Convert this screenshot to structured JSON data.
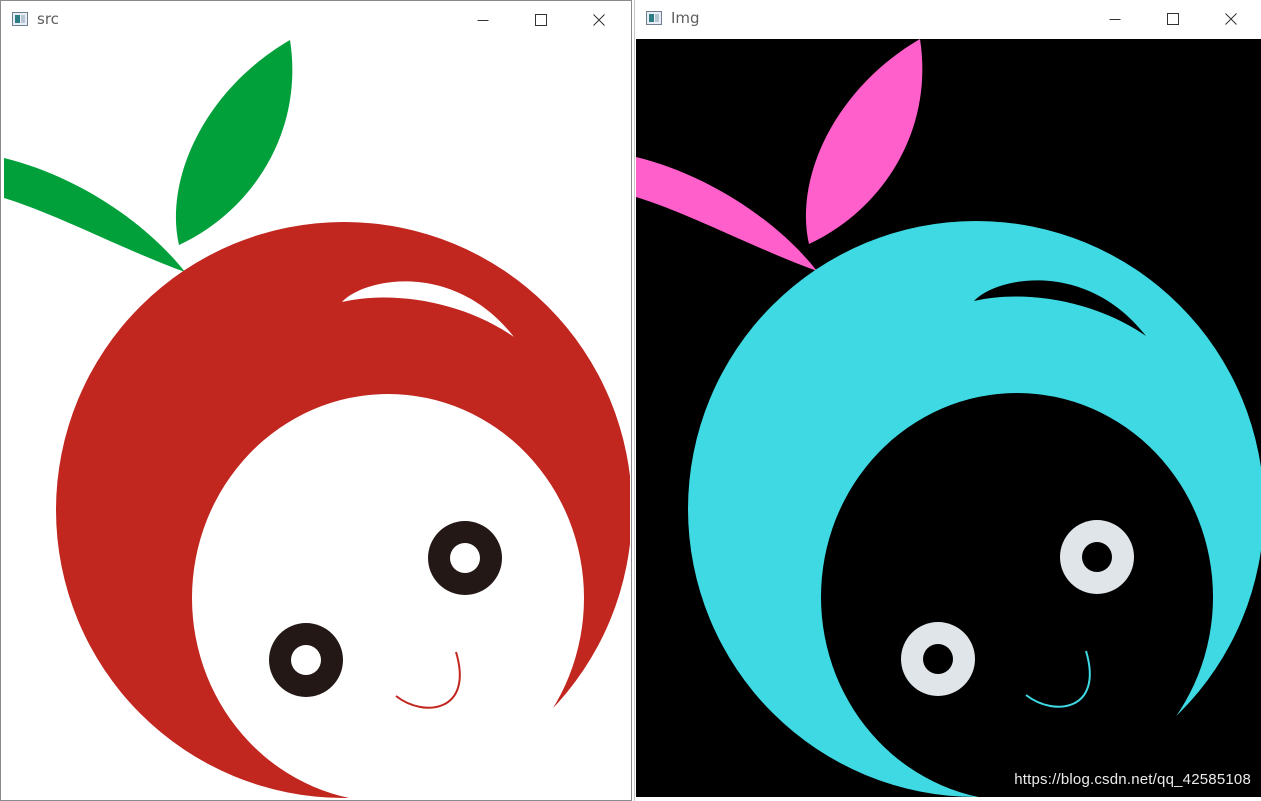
{
  "windows": [
    {
      "id": "src",
      "title": "src",
      "background": "#ffffff",
      "colors": {
        "leaf": "#01a03a",
        "body": "#c1261f",
        "face": "#ffffff",
        "eye": "#231816",
        "pupil": "#ffffff",
        "smile": "#c1261f"
      }
    },
    {
      "id": "img",
      "title": "Img",
      "background": "#000000",
      "colors": {
        "leaf": "#ff5fca",
        "body": "#3ed9e3",
        "face": "#000000",
        "eye": "#dfe5e8",
        "pupil": "#000000",
        "smile": "#3ed9e3"
      }
    }
  ],
  "controls": {
    "minimize_icon": "minimize-icon",
    "maximize_icon": "maximize-icon",
    "close_icon": "close-icon"
  },
  "watermark": "https://blog.csdn.net/qq_42585108"
}
